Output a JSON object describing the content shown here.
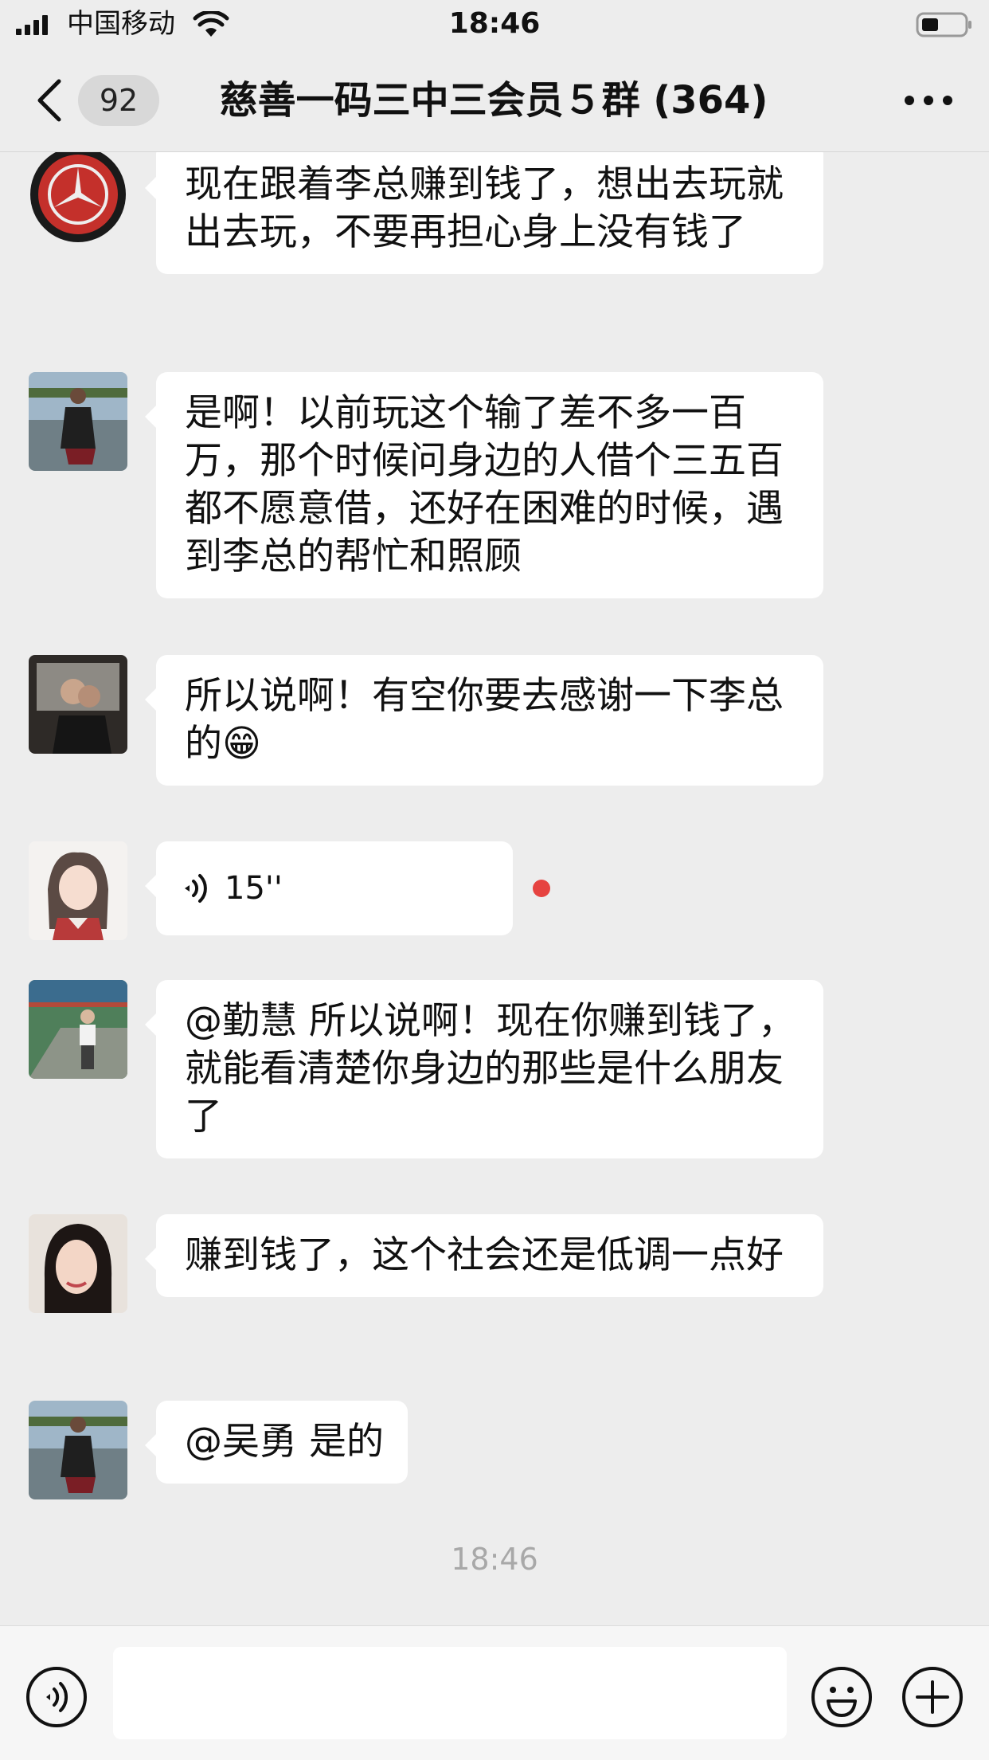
{
  "status_bar": {
    "carrier": "中国移动",
    "time": "18:46"
  },
  "nav": {
    "badge": "92",
    "title": "慈善一码三中三会员５群 (364)"
  },
  "messages": [
    {
      "type": "text",
      "avatar": "mercedes-benz-logo-avatar",
      "text": "现在跟着李总赚到钱了，想出去玩就出去玩，不要再担心身上没有钱了"
    },
    {
      "type": "text",
      "avatar": "woman-lakeside-avatar",
      "text": "是啊！以前玩这个输了差不多一百万，那个时候问身边的人借个三五百都不愿意借，还好在困难的时候，遇到李总的帮忙和照顾"
    },
    {
      "type": "text",
      "avatar": "couple-photo-avatar",
      "text": "所以说啊！有空你要去感谢一下李总的😁"
    },
    {
      "type": "voice",
      "avatar": "anime-girl-avatar",
      "duration": "15''",
      "unread": true
    },
    {
      "type": "text",
      "avatar": "man-corridor-avatar",
      "text": "@勤慧 所以说啊！现在你赚到钱了，就能看清楚你身边的那些是什么朋友了"
    },
    {
      "type": "text",
      "avatar": "woman-selfie-avatar",
      "text": "赚到钱了，这个社会还是低调一点好"
    },
    {
      "type": "text",
      "avatar": "woman-lakeside-avatar",
      "text": "@吴勇 是的"
    }
  ],
  "timestamp": "18:46",
  "colors": {
    "background": "#ededed",
    "bubble": "#ffffff",
    "unread_dot": "#e64340"
  }
}
